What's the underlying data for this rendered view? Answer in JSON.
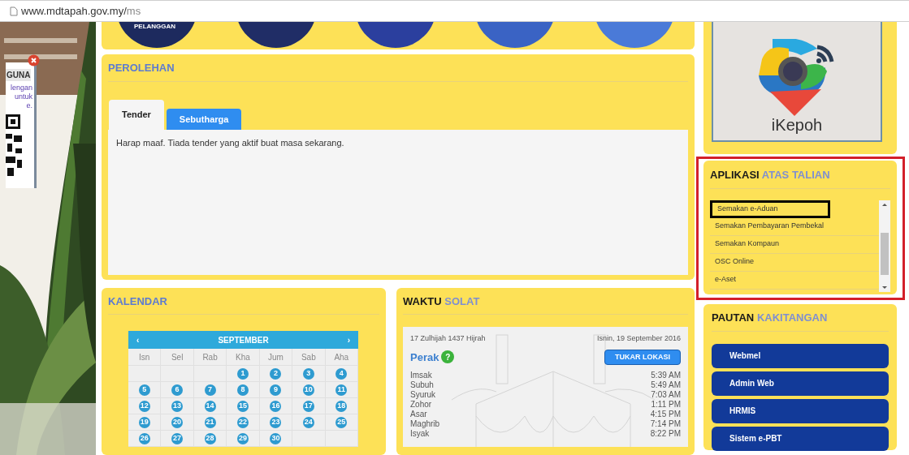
{
  "address_bar": {
    "url": "www.mdtapah.gov.my/",
    "url_path": "ms"
  },
  "popup": {
    "title": "GUNA",
    "lines": [
      "lengan",
      "untuk",
      "e."
    ]
  },
  "top_banner": {
    "caption": "PELANGGAN"
  },
  "perolehan": {
    "title": "PEROLEHAN",
    "tabs": [
      {
        "label": "Tender",
        "selected": true
      },
      {
        "label": "Sebutharga",
        "selected": false
      }
    ],
    "message": "Harap maaf. Tiada tender yang aktif buat masa sekarang."
  },
  "kalendar": {
    "title": "KALENDAR",
    "month": "SEPTEMBER",
    "prev": "‹",
    "next": "›",
    "weekdays": [
      "Isn",
      "Sel",
      "Rab",
      "Kha",
      "Jum",
      "Sab",
      "Aha"
    ],
    "weeks": [
      {
        "kind": "first",
        "days": [
          "1",
          "2",
          "3",
          "4"
        ]
      },
      {
        "kind": "full",
        "days": [
          "5",
          "6",
          "7",
          "8",
          "9",
          "10",
          "11"
        ]
      },
      {
        "kind": "full",
        "days": [
          "12",
          "13",
          "14",
          "15",
          "16",
          "17",
          "18"
        ]
      },
      {
        "kind": "full",
        "days": [
          "19",
          "20",
          "21",
          "22",
          "23",
          "24",
          "25"
        ]
      },
      {
        "kind": "last",
        "days": [
          "26",
          "27",
          "28",
          "29",
          "30"
        ]
      }
    ]
  },
  "waktu_solat": {
    "title": "WAKTU",
    "title_accent": "SOLAT",
    "hijri_date": "17 Zulhijah 1437 Hijrah",
    "date": "Isnin, 19 September 2016",
    "location": "Perak",
    "help": "?",
    "button": "TUKAR LOKASI",
    "times": [
      {
        "name": "Imsak",
        "time": "5:39 AM"
      },
      {
        "name": "Subuh",
        "time": "5:49 AM"
      },
      {
        "name": "Syuruk",
        "time": "7:03 AM"
      },
      {
        "name": "Zohor",
        "time": "1:11 PM"
      },
      {
        "name": "Asar",
        "time": "4:15 PM"
      },
      {
        "name": "Maghrib",
        "time": "7:14 PM"
      },
      {
        "name": "Isyak",
        "time": "8:22 PM"
      }
    ]
  },
  "ikepoh": {
    "label": "iKepoh"
  },
  "aplikasi": {
    "title": "APLIKASI",
    "title_accent": "ATAS TALIAN",
    "outlined": true,
    "items": [
      {
        "label": "Semakan e-Aduan",
        "highlighted": true
      },
      {
        "label": "Semakan Pembayaran Pembekal",
        "highlighted": false
      },
      {
        "label": "Semakan Kompaun",
        "highlighted": false
      },
      {
        "label": "OSC Online",
        "highlighted": false
      },
      {
        "label": "e-Aset",
        "highlighted": false
      }
    ]
  },
  "pautan": {
    "title": "PAUTAN",
    "title_accent": "KAKITANGAN",
    "links": [
      "Webmel",
      "Admin Web",
      "HRMIS",
      "Sistem e-PBT"
    ]
  }
}
